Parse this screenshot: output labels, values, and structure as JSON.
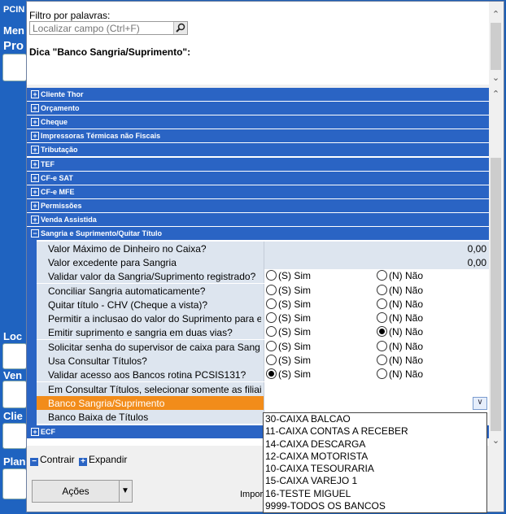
{
  "background": {
    "title_fragment": "PCIN",
    "labels": [
      "Men",
      "Pro",
      "Loc",
      "Ven",
      "Clie",
      "Plan"
    ]
  },
  "filter": {
    "label": "Filtro por palavras:",
    "placeholder": "Localizar campo (Ctrl+F)",
    "hint": "Dica \"Banco Sangria/Suprimento\":"
  },
  "categories": [
    {
      "label": "Cliente Thor",
      "expanded": false
    },
    {
      "label": "Orçamento",
      "expanded": false
    },
    {
      "label": "Cheque",
      "expanded": false
    },
    {
      "label": "Impressoras Térmicas não Fiscais",
      "expanded": false
    },
    {
      "label": "Tributação",
      "expanded": false
    },
    {
      "label": "TEF",
      "expanded": false
    },
    {
      "label": "CF-e SAT",
      "expanded": false
    },
    {
      "label": "CF-e MFE",
      "expanded": false
    },
    {
      "label": "Permissões",
      "expanded": false
    },
    {
      "label": "Venda Assistida",
      "expanded": false
    },
    {
      "label": "Sangria e Suprimento/Quitar Título",
      "expanded": true
    }
  ],
  "expand_symbols": {
    "collapsed": "+",
    "expanded": "−"
  },
  "properties": [
    {
      "label": "Valor Máximo de Dinheiro no Caixa?",
      "type": "number",
      "value": "0,00"
    },
    {
      "label": "Valor excedente para Sangria",
      "type": "number",
      "value": "0,00"
    },
    {
      "label": "Validar valor da Sangria/Suprimento registrado?",
      "type": "radio",
      "selected": "none"
    },
    {
      "label": "Conciliar Sangria automaticamente?",
      "type": "radio",
      "selected": "none"
    },
    {
      "label": "Quitar título - CHV (Cheque a vista)?",
      "type": "radio",
      "selected": "none"
    },
    {
      "label": "Permitir a inclusao do valor do Suprimento para efetuar",
      "type": "radio",
      "selected": "none"
    },
    {
      "label": "Emitir suprimento e sangria em duas vias?",
      "type": "radio",
      "selected": "no"
    },
    {
      "label": "Solicitar senha do supervisor de caixa para Sang./Sup",
      "type": "radio",
      "selected": "none"
    },
    {
      "label": "Usa Consultar Títulos?",
      "type": "radio",
      "selected": "none"
    },
    {
      "label": "Validar acesso aos Bancos rotina PCSIS131?",
      "type": "radio",
      "selected": "yes"
    },
    {
      "label": "Em Consultar Títulos, selecionar somente as filiais?",
      "type": "empty"
    },
    {
      "label": "Banco Sangria/Suprimento",
      "type": "combo",
      "value": ""
    },
    {
      "label": "Banco Baixa de Títulos",
      "type": "empty"
    }
  ],
  "radio_labels": {
    "yes": "(S) Sim",
    "no": "(N) Não"
  },
  "ecf_category": {
    "label": "ECF"
  },
  "dropdown": {
    "options": [
      "30-CAIXA BALCAO",
      "11-CAIXA CONTAS A RECEBER",
      "14-CAIXA DESCARGA",
      "12-CAIXA MOTORISTA",
      "10-CAIXA TESOURARIA",
      "15-CAIXA VAREJO 1",
      "16-TESTE MIGUEL",
      "9999-TODOS OS BANCOS"
    ]
  },
  "toolbar": {
    "collapse_label": "Contrair",
    "expand_label": "Expandir"
  },
  "footer": {
    "actions_label": "Ações",
    "import_label": "Impor"
  },
  "colors": {
    "category_blue": "#2a64c4",
    "selected_orange": "#f28c1a",
    "property_bg": "#dde5ef"
  }
}
